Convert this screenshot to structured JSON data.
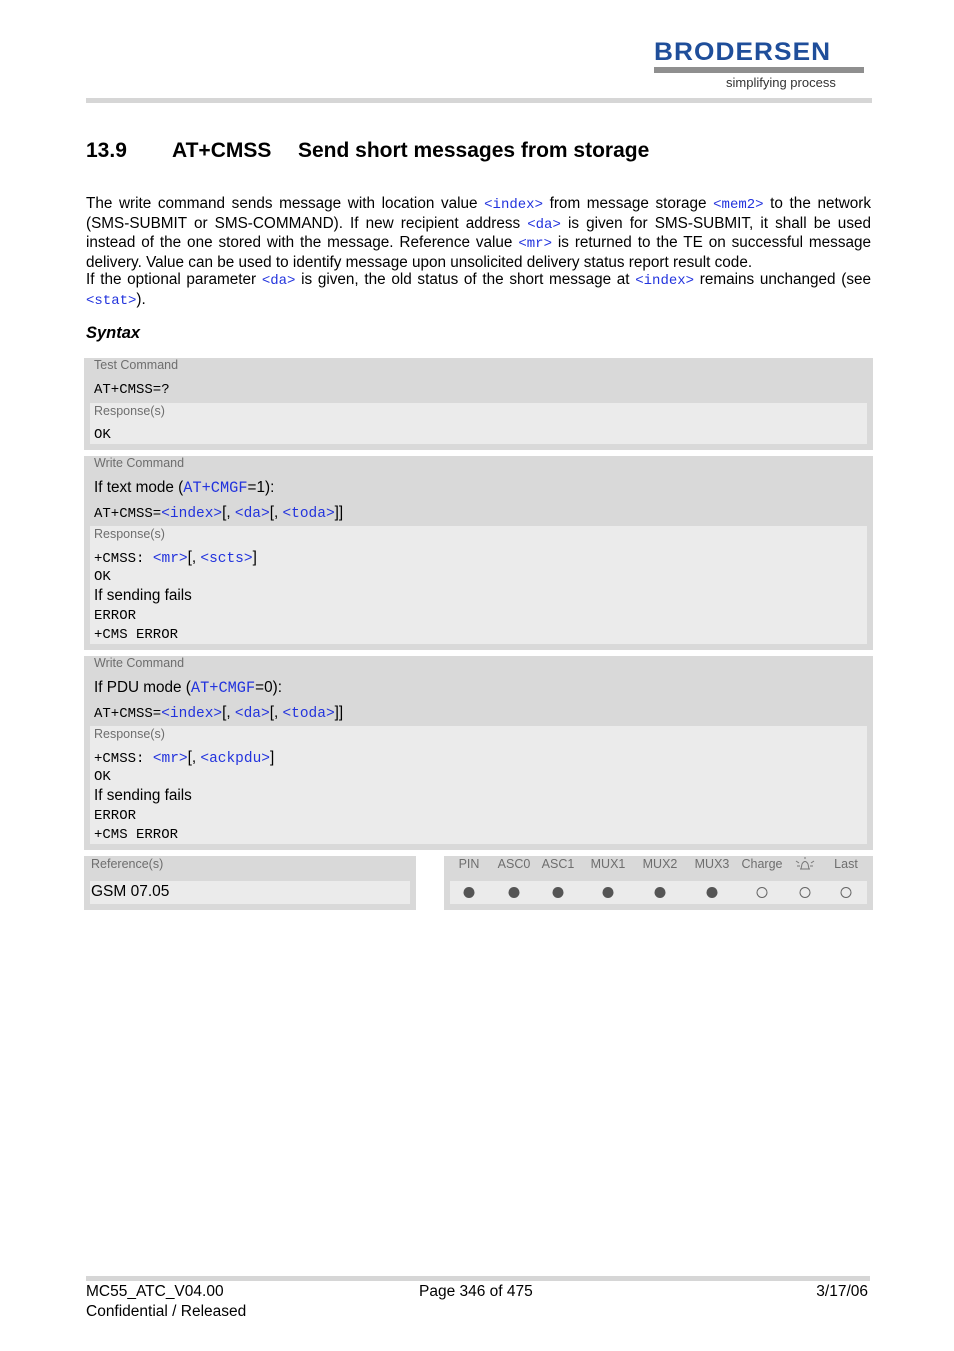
{
  "header": {
    "logo_word": "BRODERSEN",
    "logo_tagline": "simplifying process",
    "brand_color": "#1f4e9a"
  },
  "section": {
    "number": "13.9",
    "command": "AT+CMSS",
    "title": "Send short messages from storage"
  },
  "intro": {
    "p1_a": "The write command sends message with location value ",
    "p1_index": "<index>",
    "p1_b": " from message storage ",
    "p1_mem2": "<mem2>",
    "p1_c": " to the network (SMS-SUBMIT or SMS-COMMAND). If new recipient address ",
    "p1_da": "<da>",
    "p1_d": " is given for SMS-SUBMIT, it shall be used instead of the one stored with the message. Reference value ",
    "p1_mr": "<mr>",
    "p1_e": " is returned to the TE on successful message delivery. Value can be used to identify message upon unsolicited delivery status report result code.",
    "p2_a": "If the optional parameter ",
    "p2_da": "<da>",
    "p2_b": " is given, the old status of the short message at ",
    "p2_index": "<index>",
    "p2_c": " remains unchanged (see ",
    "p2_stat": "<stat>",
    "p2_d": ")."
  },
  "syntax_label": "Syntax",
  "test_command": {
    "label": "Test Command",
    "command": "AT+CMSS=?",
    "response_label": "Response(s)",
    "response": "OK"
  },
  "write_text": {
    "label": "Write Command",
    "mode_a": "If text mode (",
    "mode_link": "AT+CMGF",
    "mode_b": "=1):",
    "cmd_prefix": "AT+CMSS=",
    "p_index": "<index>",
    "sep1": "[, ",
    "p_da": "<da>",
    "sep2": "[, ",
    "p_toda": "<toda>",
    "close": "]]",
    "response_label": "Response(s)",
    "resp_prefix": "+CMSS: ",
    "r_mr": "<mr>",
    "r_sep": "[, ",
    "r_param": "<scts>",
    "r_close": "]",
    "ok": "OK",
    "fail_text": "If sending fails",
    "error": "ERROR",
    "cms_error": "+CMS ERROR"
  },
  "write_pdu": {
    "label": "Write Command",
    "mode_a": "If PDU mode (",
    "mode_link": "AT+CMGF",
    "mode_b": "=0):",
    "cmd_prefix": "AT+CMSS=",
    "p_index": "<index>",
    "sep1": "[, ",
    "p_da": "<da>",
    "sep2": "[, ",
    "p_toda": "<toda>",
    "close": "]]",
    "response_label": "Response(s)",
    "resp_prefix": "+CMSS: ",
    "r_mr": "<mr>",
    "r_sep": "[, ",
    "r_param": "<ackpdu>",
    "r_close": "]",
    "ok": "OK",
    "fail_text": "If sending fails",
    "error": "ERROR",
    "cms_error": "+CMS ERROR"
  },
  "reference": {
    "label": "Reference(s)",
    "value": "GSM 07.05"
  },
  "status_table": {
    "columns": [
      {
        "label": "PIN",
        "state": "filled"
      },
      {
        "label": "ASC0",
        "state": "filled"
      },
      {
        "label": "ASC1",
        "state": "filled"
      },
      {
        "label": "MUX1",
        "state": "filled"
      },
      {
        "label": "MUX2",
        "state": "filled"
      },
      {
        "label": "MUX3",
        "state": "filled"
      },
      {
        "label": "Charge",
        "state": "empty"
      },
      {
        "label": "",
        "icon": "alarm-bell-icon",
        "state": "empty"
      },
      {
        "label": "Last",
        "state": "empty"
      }
    ]
  },
  "footer": {
    "doc_id": "MC55_ATC_V04.00",
    "classification": "Confidential / Released",
    "page": "Page 346 of 475",
    "date": "3/17/06"
  }
}
